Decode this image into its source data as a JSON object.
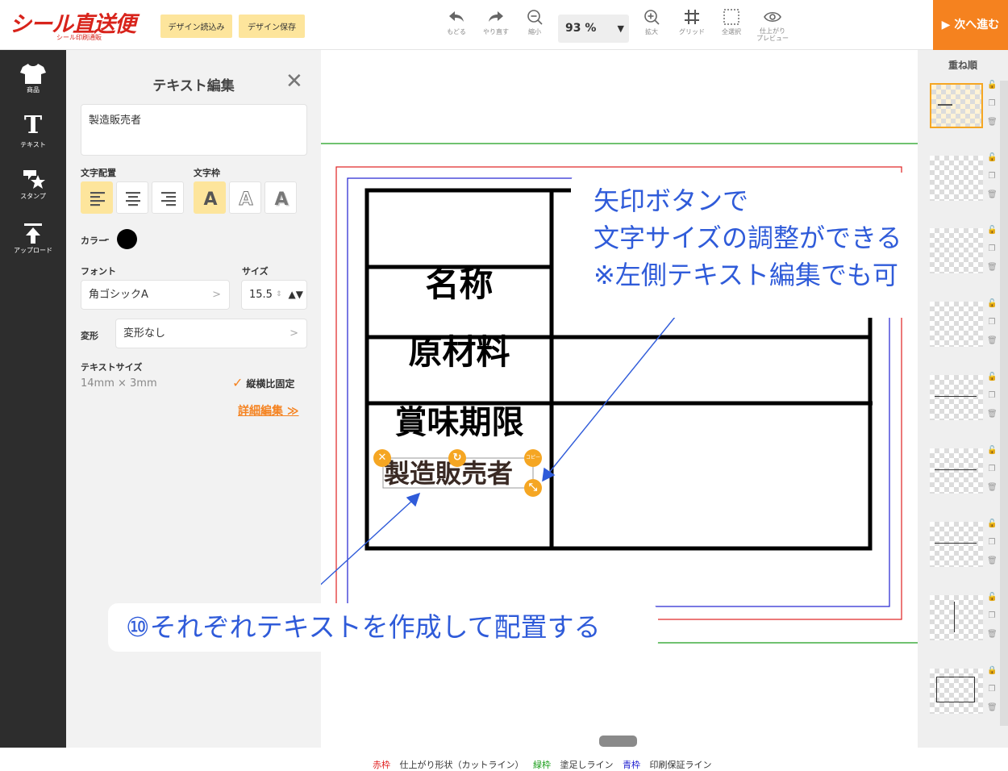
{
  "header": {
    "logo": "シール直送便",
    "logo_sub": "シール印刷通販",
    "load_design": "デザイン読込み",
    "save_design": "デザイン保存",
    "undo": "もどる",
    "redo": "やり直す",
    "zoom_out": "縮小",
    "zoom_value": "93 %",
    "zoom_in": "拡大",
    "grid": "グリッド",
    "select_all": "全選択",
    "preview_line1": "仕上がり",
    "preview_line2": "プレビュー",
    "next": "▶ 次へ進む"
  },
  "leftnav": {
    "items": [
      {
        "label": "商品",
        "icon": "tshirt-icon"
      },
      {
        "label": "テキスト",
        "icon": "text-icon"
      },
      {
        "label": "スタンプ",
        "icon": "stamp-icon"
      },
      {
        "label": "アップロード",
        "icon": "upload-icon"
      }
    ]
  },
  "panel": {
    "title": "テキスト編集",
    "text_value": "製造販売者",
    "align_label": "文字配置",
    "frame_label": "文字枠",
    "color_label": "カラー",
    "color_value": "#000000",
    "font_label": "フォント",
    "font_value": "角ゴシックA",
    "size_label": "サイズ",
    "size_value": "15.5",
    "transform_label": "変形",
    "transform_value": "変形なし",
    "text_size_label": "テキストサイズ",
    "text_size_value": "14mm × 3mm",
    "keep_ratio": "縦横比固定",
    "detail_edit": "詳細編集 ≫"
  },
  "canvas": {
    "cells": [
      "名称",
      "原材料",
      "賞味期限"
    ],
    "selected_text": "製造販売者",
    "copy_badge": "コピー"
  },
  "callouts": {
    "top_line1": "矢印ボタンで",
    "top_line2": "文字サイズの調整ができる",
    "top_line3": "※左側テキスト編集でも可",
    "bottom": "⑩それぞれテキストを作成して配置する"
  },
  "legend": {
    "red_label": "赤枠",
    "red_desc": "仕上がり形状（カットライン）",
    "green_label": "緑枠",
    "green_desc": "塗足しライン",
    "blue_label": "青枠",
    "blue_desc": "印刷保証ライン",
    "red_color": "#e02020",
    "green_color": "#1a9e1a",
    "blue_color": "#2020d0"
  },
  "layers": {
    "title": "重ね順"
  },
  "colors": {
    "accent": "#f5821f",
    "button_yellow": "#fde59c",
    "brand_red": "#d8231b",
    "callout_blue": "#2f5bd9"
  }
}
